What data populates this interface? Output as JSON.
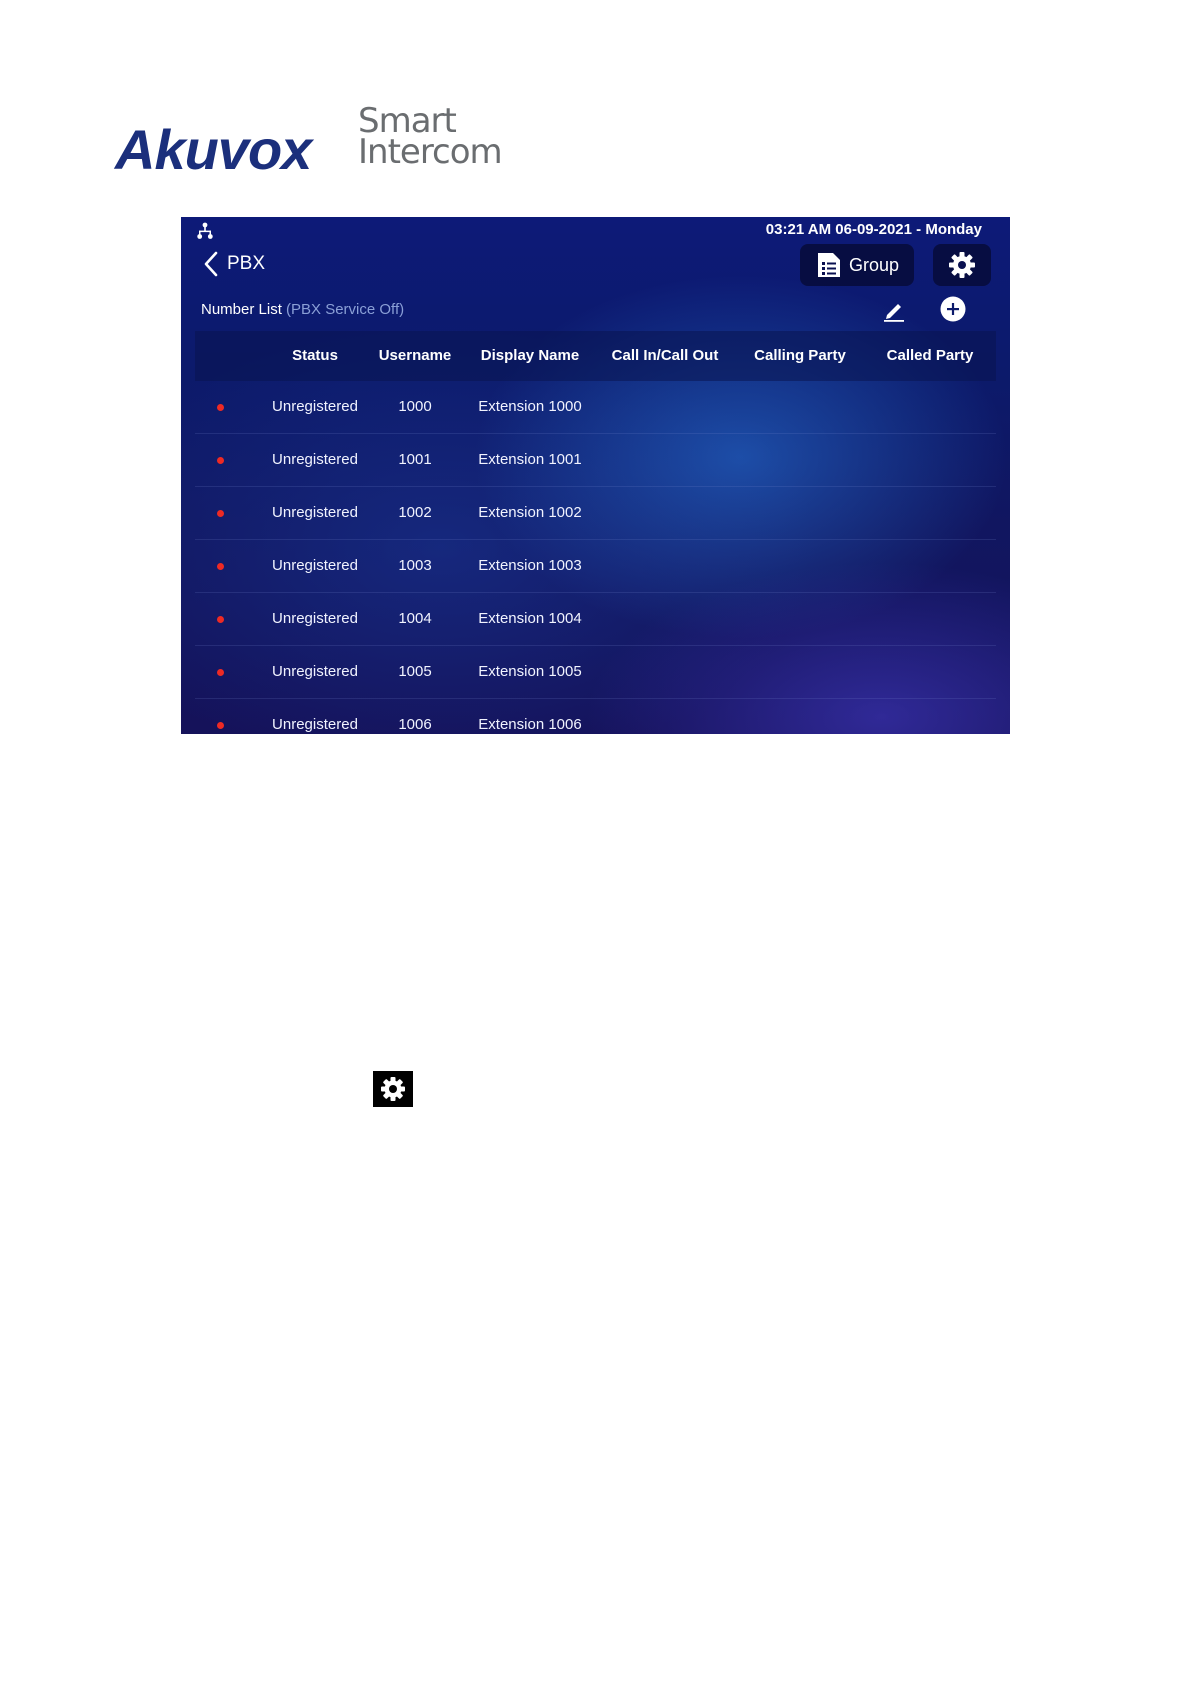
{
  "logo": {
    "brand": "Akuvox",
    "tagline_line1": "Smart",
    "tagline_line2": "Intercom"
  },
  "status_bar": {
    "datetime": "03:21 AM  06-09-2021 - Monday"
  },
  "header": {
    "back_label": "PBX",
    "group_label": "Group"
  },
  "list": {
    "title": "Number List",
    "status_note": "(PBX Service Off)"
  },
  "table": {
    "columns": [
      "Status",
      "Username",
      "Display Name",
      "Call In/Call Out",
      "Calling Party",
      "Called Party"
    ],
    "rows": [
      {
        "status": "Unregistered",
        "username": "1000",
        "display_name": "Extension 1000"
      },
      {
        "status": "Unregistered",
        "username": "1001",
        "display_name": "Extension 1001"
      },
      {
        "status": "Unregistered",
        "username": "1002",
        "display_name": "Extension 1002"
      },
      {
        "status": "Unregistered",
        "username": "1003",
        "display_name": "Extension 1003"
      },
      {
        "status": "Unregistered",
        "username": "1004",
        "display_name": "Extension 1004"
      },
      {
        "status": "Unregistered",
        "username": "1005",
        "display_name": "Extension 1005"
      },
      {
        "status": "Unregistered",
        "username": "1006",
        "display_name": "Extension 1006"
      }
    ]
  },
  "icons": {
    "network": "network-icon",
    "back": "chevron-left-icon",
    "group": "group-list-icon",
    "settings": "gear-icon",
    "edit": "edit-pencil-icon",
    "add": "add-circle-icon",
    "standalone": "gear-icon"
  },
  "colors": {
    "brand_blue": "#1b2f7c",
    "tagline_gray": "#6a6d70",
    "status_red": "#ee2a24"
  }
}
